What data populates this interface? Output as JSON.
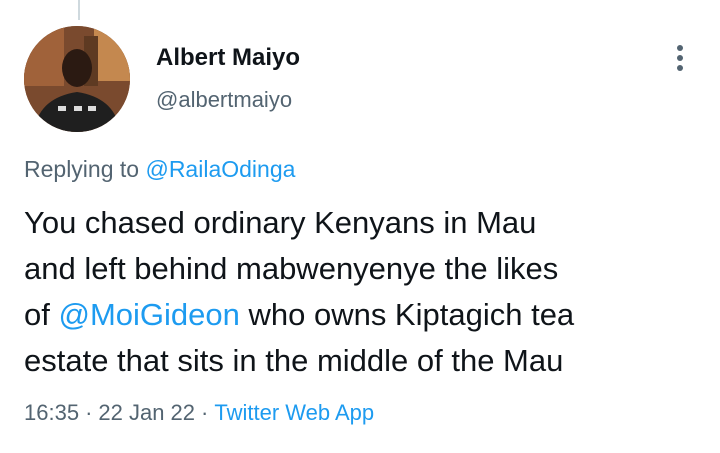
{
  "tweet": {
    "author_name": "Albert Maiyo",
    "author_handle": "@albertmaiyo",
    "reply_prefix": "Replying to ",
    "reply_to_handle": "@RailaOdinga",
    "text_lines": [
      "You chased ordinary Kenyans in Mau",
      "and left behind mabwenyenye the likes"
    ],
    "line3_prefix": "of ",
    "line3_mention": "@MoiGideon",
    "line3_suffix": " who owns Kiptagich tea",
    "line4": "estate that sits in the middle of the Mau",
    "time": "16:35",
    "date": "22 Jan 22",
    "source": "Twitter Web App",
    "separator": "·"
  },
  "icons": {
    "more": "more-vertical-icon",
    "avatar": "profile-photo"
  },
  "colors": {
    "link": "#1d9bf0",
    "secondary_text": "#536471",
    "primary_text": "#0f1419"
  }
}
